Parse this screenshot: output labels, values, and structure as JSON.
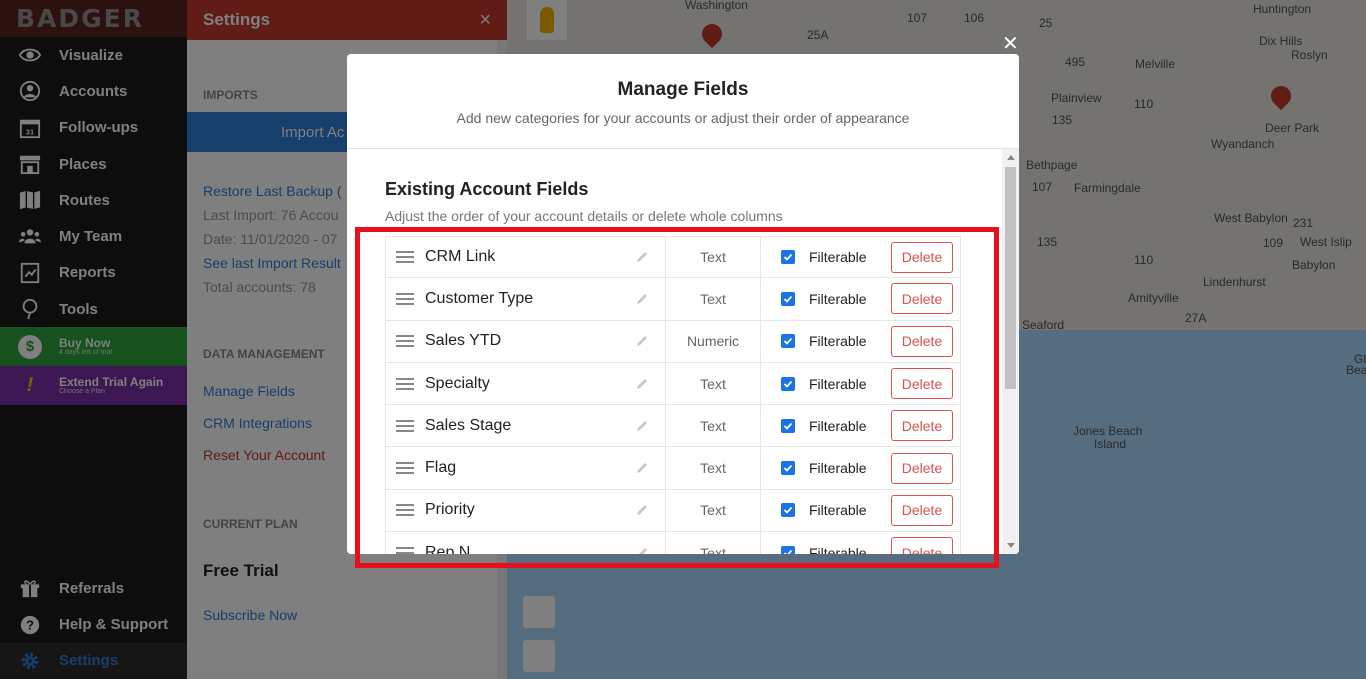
{
  "app": {
    "logo": "BADGER"
  },
  "sidebar": {
    "items": [
      {
        "label": "Visualize",
        "icon": "eye-icon"
      },
      {
        "label": "Accounts",
        "icon": "person-icon"
      },
      {
        "label": "Follow-ups",
        "icon": "calendar-icon"
      },
      {
        "label": "Places",
        "icon": "store-icon"
      },
      {
        "label": "Routes",
        "icon": "map-icon"
      },
      {
        "label": "My Team",
        "icon": "team-icon"
      },
      {
        "label": "Reports",
        "icon": "reports-icon"
      },
      {
        "label": "Tools",
        "icon": "tools-icon"
      }
    ],
    "buy_now": {
      "title": "Buy Now",
      "sub": "4 days left of trial",
      "icon": "dollar-icon"
    },
    "extend_trial": {
      "title": "Extend Trial Again",
      "sub": "Choose a Plan",
      "icon": "exclamation-icon"
    },
    "bottom": [
      {
        "label": "Referrals",
        "icon": "gift-icon"
      },
      {
        "label": "Help & Support",
        "icon": "help-icon"
      },
      {
        "label": "Settings",
        "icon": "gear-icon"
      }
    ]
  },
  "settings": {
    "title": "Settings",
    "imports_title": "IMPORTS",
    "import_button": "Import Ac",
    "restore_link": "Restore Last Backup (",
    "last_import": "Last Import: 76 Accou",
    "date": "Date: 11/01/2020 - 07",
    "see_results": "See last Import Result",
    "total_accounts": "Total accounts: 78",
    "data_mgmt_title": "DATA MANAGEMENT",
    "manage_fields": "Manage Fields",
    "crm_integrations": "CRM Integrations",
    "reset_account": "Reset Your Account",
    "current_plan_title": "CURRENT PLAN",
    "plan_name": "Free Trial",
    "subscribe": "Subscribe Now"
  },
  "map": {
    "labels": [
      "Washington",
      "Huntington",
      "Dix Hills",
      "Melville",
      "Plainview",
      "Deer Park",
      "Wyandanch",
      "Bethpage",
      "Farmingdale",
      "West Babylon",
      "West Islip",
      "Babylon",
      "Lindenhurst",
      "Amityville",
      "Seaford",
      "Jones Beach",
      "Island",
      "Roslyn",
      "Gl",
      "Bea"
    ],
    "road_numbers": [
      "107",
      "106",
      "25",
      "25A",
      "495",
      "110",
      "135",
      "107",
      "231",
      "109",
      "110",
      "27A",
      "135"
    ]
  },
  "modal": {
    "title": "Manage Fields",
    "subtitle": "Add new categories for your accounts or adjust their order of appearance",
    "section_title": "Existing Account Fields",
    "section_sub": "Adjust the order of your account details or delete whole columns",
    "filter_label": "Filterable",
    "delete_label": "Delete",
    "fields": [
      {
        "name": "CRM Link",
        "type": "Text"
      },
      {
        "name": "Customer Type",
        "type": "Text"
      },
      {
        "name": "Sales YTD",
        "type": "Numeric"
      },
      {
        "name": "Specialty",
        "type": "Text"
      },
      {
        "name": "Sales Stage",
        "type": "Text"
      },
      {
        "name": "Flag",
        "type": "Text"
      },
      {
        "name": "Priority",
        "type": "Text"
      },
      {
        "name": "Rep N",
        "type": "Text"
      }
    ]
  },
  "colors": {
    "sidebar_bg": "#1b1b1b",
    "settings_header": "#c0392b",
    "accent_blue": "#2f7fd6",
    "buy_green": "#2ea23a",
    "trial_purple": "#7b2fa8",
    "delete_red": "#d9534f",
    "highlight_red": "#e8101e"
  }
}
